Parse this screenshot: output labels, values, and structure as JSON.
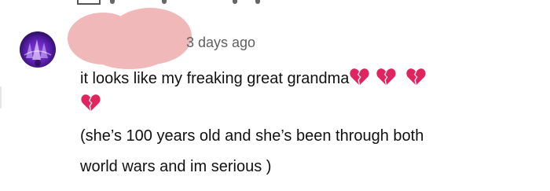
{
  "comment": {
    "timestamp": "3 days ago",
    "text": {
      "line1": "it looks like my freaking great grandma",
      "line3": "(she’s 100 years old and she’s been through both",
      "line4": "world wars and im serious )"
    },
    "emoji": {
      "name": "broken-heart",
      "count": 4,
      "color": "#e0245e"
    }
  }
}
